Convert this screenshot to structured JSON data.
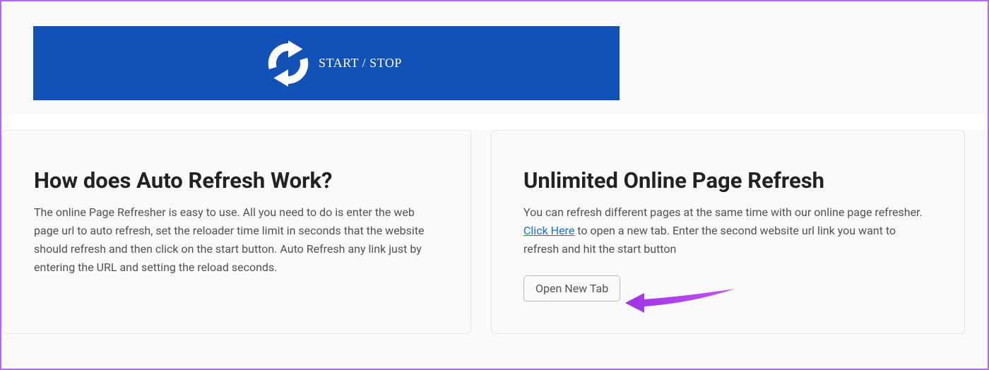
{
  "banner": {
    "label": "START / STOP"
  },
  "cards": {
    "left": {
      "heading": "How does Auto Refresh Work?",
      "body": "The online Page Refresher is easy to use. All you need to do is enter the web page url to auto refresh, set the reloader time limit in seconds that the website should refresh and then click on the start button. Auto Refresh any link just by entering the URL and setting the reload seconds."
    },
    "right": {
      "heading": "Unlimited Online Page Refresh",
      "body_before": "You can refresh different pages at the same time with our online page refresher. ",
      "link_text": "Click Here",
      "body_after": " to open a new tab. Enter the second website url link you want to refresh and hit the start button",
      "button_label": "Open New Tab"
    }
  }
}
